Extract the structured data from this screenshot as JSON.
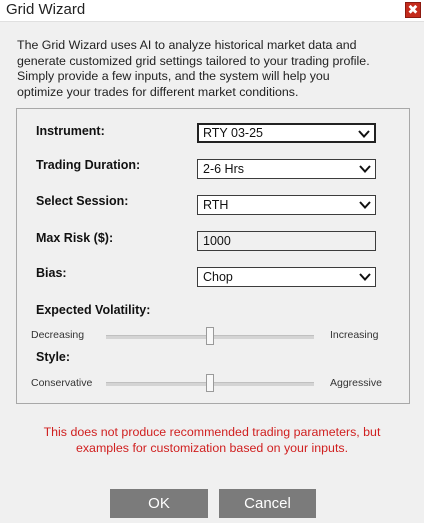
{
  "window": {
    "title": "Grid Wizard",
    "close_glyph": "✖",
    "close_icon": "close-icon"
  },
  "intro": {
    "line1": "The Grid Wizard uses AI to analyze historical market data and",
    "line2": "generate customized grid settings tailored to your trading profile.",
    "line3": "Simply provide a few inputs, and the system will help you",
    "line4": "optimize your trades for different market conditions."
  },
  "form": {
    "instrument": {
      "label": "Instrument:",
      "value": "RTY 03-25"
    },
    "duration": {
      "label": "Trading Duration:",
      "value": "2-6 Hrs"
    },
    "session": {
      "label": "Select Session:",
      "value": "RTH"
    },
    "max_risk": {
      "label": "Max Risk ($):",
      "value": "1000"
    },
    "bias": {
      "label": "Bias:",
      "value": "Chop"
    },
    "volatility": {
      "label": "Expected Volatility:",
      "min_label": "Decreasing",
      "max_label": "Increasing",
      "level": 0.5
    },
    "style": {
      "label": "Style:",
      "min_label": "Conservative",
      "max_label": "Aggressive",
      "level": 0.5
    }
  },
  "disclaimer": {
    "line1": "This does not produce recommended trading parameters, but",
    "line2": "examples for customization based on your inputs."
  },
  "buttons": {
    "ok": "OK",
    "cancel": "Cancel"
  },
  "colors": {
    "disclaimer": "#d01f1f",
    "button_bg": "#7b7b7b",
    "close_bg": "#c42b1c"
  }
}
